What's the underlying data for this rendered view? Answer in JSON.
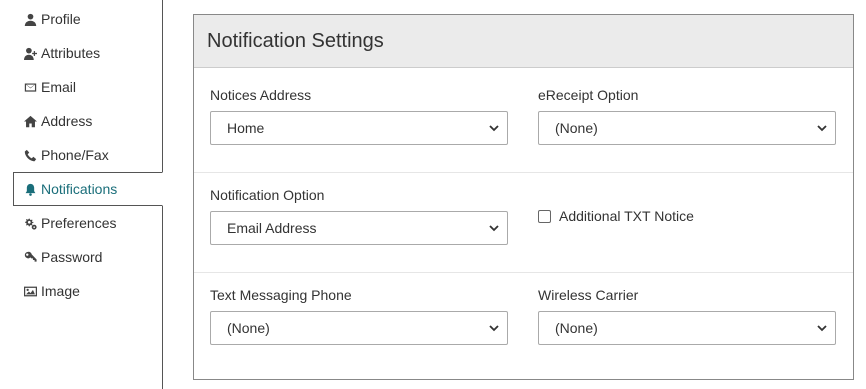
{
  "sidebar": {
    "items": [
      {
        "label": "Profile",
        "icon": "user-icon"
      },
      {
        "label": "Attributes",
        "icon": "user-plus-icon"
      },
      {
        "label": "Email",
        "icon": "envelope-icon"
      },
      {
        "label": "Address",
        "icon": "home-icon"
      },
      {
        "label": "Phone/Fax",
        "icon": "phone-icon"
      },
      {
        "label": "Notifications",
        "icon": "bell-icon",
        "active": true
      },
      {
        "label": "Preferences",
        "icon": "cogs-icon"
      },
      {
        "label": "Password",
        "icon": "key-icon"
      },
      {
        "label": "Image",
        "icon": "image-icon"
      }
    ]
  },
  "panel": {
    "title": "Notification Settings",
    "notices_address": {
      "label": "Notices Address",
      "value": "Home"
    },
    "ereceipt_option": {
      "label": "eReceipt Option",
      "value": "(None)"
    },
    "notification_option": {
      "label": "Notification Option",
      "value": "Email Address"
    },
    "additional_txt": {
      "label": "Additional TXT Notice",
      "checked": false
    },
    "text_phone": {
      "label": "Text Messaging Phone",
      "value": "(None)"
    },
    "wireless_carrier": {
      "label": "Wireless Carrier",
      "value": "(None)"
    }
  },
  "colors": {
    "accent": "#1a6e7a",
    "header_bg": "#ebebeb",
    "border": "#aaaaaa"
  }
}
